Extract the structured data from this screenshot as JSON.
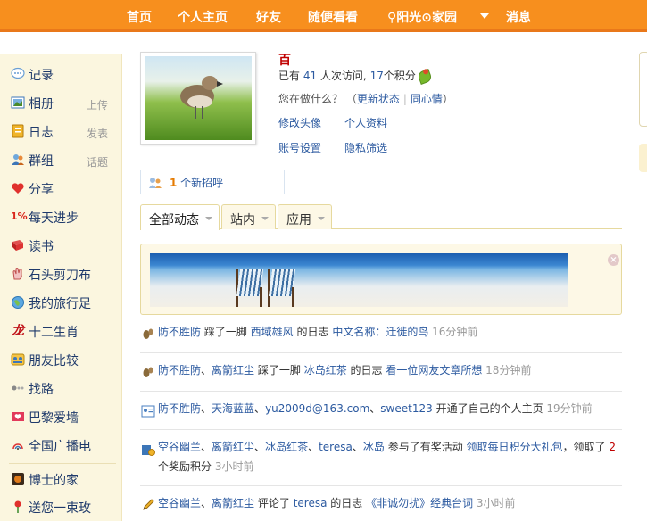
{
  "nav": {
    "items": [
      "首页",
      "个人主页",
      "好友",
      "随便看看",
      "♀阳光⊙家园",
      "消息"
    ]
  },
  "sidebar": {
    "items": [
      {
        "label": "记录",
        "icon": "speech-bubble-icon"
      },
      {
        "label": "相册",
        "sub": "上传",
        "icon": "photo-icon"
      },
      {
        "label": "日志",
        "sub": "发表",
        "icon": "diary-icon"
      },
      {
        "label": "群组",
        "sub": "话题",
        "icon": "group-icon"
      },
      {
        "label": "分享",
        "icon": "heart-icon"
      },
      {
        "label": "每天进步",
        "icon": "percent-icon"
      },
      {
        "label": "读书",
        "icon": "book-icon"
      },
      {
        "label": "石头剪刀布",
        "icon": "hand-icon"
      },
      {
        "label": "我的旅行足",
        "icon": "globe-icon"
      },
      {
        "label": "十二生肖",
        "icon": "dragon-icon"
      },
      {
        "label": "朋友比较",
        "icon": "compare-icon"
      },
      {
        "label": "找路",
        "icon": "route-icon"
      },
      {
        "label": "巴黎爱墙",
        "icon": "love-wall-icon"
      },
      {
        "label": "全国广播电",
        "icon": "radio-icon"
      },
      {
        "label": "博士的家",
        "icon": "house-icon"
      },
      {
        "label": "送您一束玫",
        "icon": "rose-icon"
      }
    ]
  },
  "profile": {
    "name": "百",
    "stats_pre": "已有 ",
    "visits": "41",
    "stats_mid": " 人次访问, ",
    "points": "17",
    "stats_post": "个积分",
    "status_prompt": "您在做什么？",
    "update_status": "更新状态",
    "same_mood": "同心情",
    "links": [
      "修改头像",
      "个人资料",
      "账号设置",
      "隐私筛选"
    ]
  },
  "greeting": {
    "count": "1",
    "text": " 个新招呼"
  },
  "tabs": [
    "全部动态",
    "站内",
    "应用"
  ],
  "colors": {
    "nav": "#f78f1e",
    "link": "#2c5aa0",
    "sidebar_bg": "#fbf6df"
  },
  "feed": [
    {
      "icon": "footprint-icon",
      "parts": [
        {
          "text": "防不胜防",
          "c": "u"
        },
        {
          "text": " 踩了一脚 ",
          "c": ""
        },
        {
          "text": "西域雄风",
          "c": "u"
        },
        {
          "text": " 的日志 ",
          "c": ""
        },
        {
          "text": "中文名称：迁徙的鸟",
          "c": "u"
        },
        {
          "text": " 16分钟前",
          "c": "t"
        }
      ]
    },
    {
      "icon": "footprint-icon",
      "parts": [
        {
          "text": "防不胜防",
          "c": "u"
        },
        {
          "text": "、",
          "c": ""
        },
        {
          "text": "离箭红尘",
          "c": "u"
        },
        {
          "text": " 踩了一脚 ",
          "c": ""
        },
        {
          "text": "冰岛红茶",
          "c": "u"
        },
        {
          "text": " 的日志 ",
          "c": ""
        },
        {
          "text": "看一位网友文章所想",
          "c": "u"
        },
        {
          "text": " 18分钟前",
          "c": "t"
        }
      ]
    },
    {
      "icon": "profile-card-icon",
      "parts": [
        {
          "text": "防不胜防",
          "c": "u"
        },
        {
          "text": "、",
          "c": ""
        },
        {
          "text": "天海蓝蓝",
          "c": "u"
        },
        {
          "text": "、",
          "c": ""
        },
        {
          "text": "yu2009d@163.com",
          "c": "u"
        },
        {
          "text": "、",
          "c": ""
        },
        {
          "text": "sweet123",
          "c": "u"
        },
        {
          "text": " 开通了自己的个人主页 ",
          "c": ""
        },
        {
          "text": "19分钟前",
          "c": "t"
        }
      ]
    },
    {
      "icon": "gift-icon",
      "parts": [
        {
          "text": "空谷幽兰",
          "c": "u"
        },
        {
          "text": "、",
          "c": ""
        },
        {
          "text": "离箭红尘",
          "c": "u"
        },
        {
          "text": "、",
          "c": ""
        },
        {
          "text": "冰岛红茶",
          "c": "u"
        },
        {
          "text": "、",
          "c": ""
        },
        {
          "text": "teresa",
          "c": "u"
        },
        {
          "text": "、",
          "c": ""
        },
        {
          "text": "冰岛",
          "c": "u"
        },
        {
          "text": " 参与了有奖活动 ",
          "c": ""
        },
        {
          "text": "领取每日积分大礼包",
          "c": "u"
        },
        {
          "text": "，领取了 ",
          "c": ""
        },
        {
          "text": "2",
          "c": "red"
        },
        {
          "text": " 个奖励积分 ",
          "c": ""
        },
        {
          "text": "3小时前",
          "c": "t"
        }
      ]
    },
    {
      "icon": "pencil-icon",
      "parts": [
        {
          "text": "空谷幽兰",
          "c": "u"
        },
        {
          "text": "、",
          "c": ""
        },
        {
          "text": "离箭红尘",
          "c": "u"
        },
        {
          "text": " 评论了 ",
          "c": ""
        },
        {
          "text": "teresa",
          "c": "u"
        },
        {
          "text": " 的日志 ",
          "c": ""
        },
        {
          "text": "《非诚勿扰》经典台词",
          "c": "u"
        },
        {
          "text": " 3小时前",
          "c": "t"
        }
      ]
    }
  ]
}
